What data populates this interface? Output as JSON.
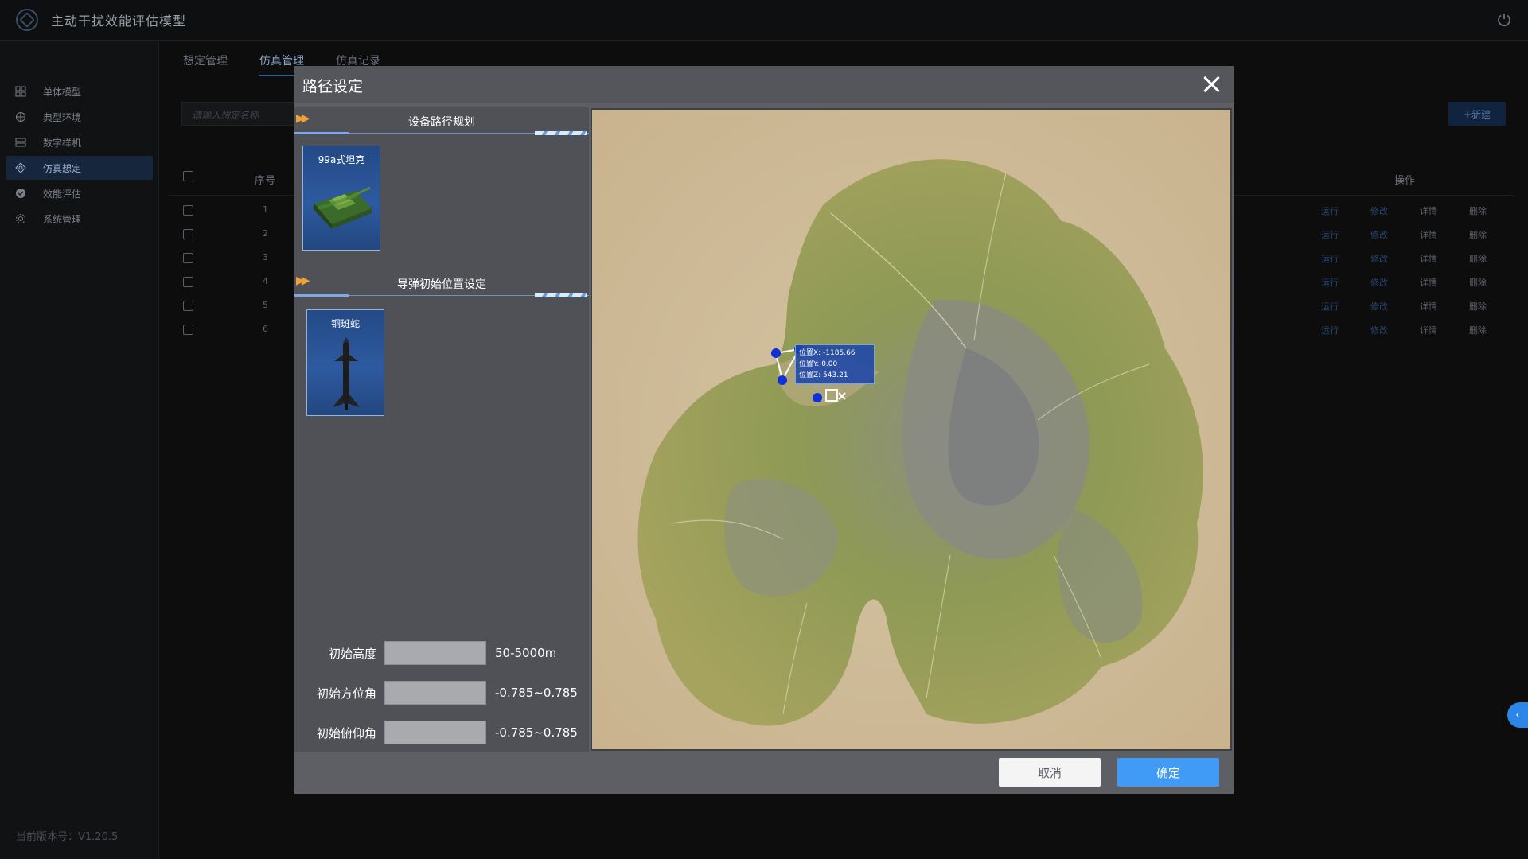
{
  "app": {
    "title": "主动干扰效能评估模型",
    "version_text": "当前版本号：V1.20.5"
  },
  "sidebar": {
    "items": [
      {
        "label": "单体模型",
        "icon": "model-icon"
      },
      {
        "label": "典型环境",
        "icon": "environment-icon"
      },
      {
        "label": "数字样机",
        "icon": "prototype-icon"
      },
      {
        "label": "仿真想定",
        "icon": "scenario-icon",
        "active": true
      },
      {
        "label": "效能评估",
        "icon": "evaluation-icon"
      },
      {
        "label": "系统管理",
        "icon": "settings-icon"
      }
    ]
  },
  "main": {
    "tabs": [
      "想定管理",
      "仿真管理",
      "仿真记录"
    ],
    "active_tab": 1,
    "search_placeholder": "请输入想定名称",
    "new_button": "+新建",
    "table": {
      "headers": {
        "index": "序号",
        "operations": "操作"
      },
      "rows": [
        {
          "index": "1"
        },
        {
          "index": "2"
        },
        {
          "index": "3"
        },
        {
          "index": "4"
        },
        {
          "index": "5"
        },
        {
          "index": "6"
        }
      ],
      "ops": {
        "run": "运行",
        "edit": "修改",
        "detail": "详情",
        "delete": "删除"
      }
    }
  },
  "dialog": {
    "title": "路径设定",
    "section1_title": "设备路径规划",
    "section2_title": "导弹初始位置设定",
    "tank_label": "99a式坦克",
    "missile_label": "铜斑蛇",
    "params": [
      {
        "label": "初始高度",
        "value": "",
        "range": "50-5000m"
      },
      {
        "label": "初始方位角",
        "value": "",
        "range": "-0.785~0.785"
      },
      {
        "label": "初始俯仰角",
        "value": "",
        "range": "-0.785~0.785"
      }
    ],
    "tooltip": {
      "x": "位置X: -1185.66",
      "y": "位置Y: 0.00",
      "z": "位置Z: 543.21"
    },
    "cancel_button": "取消",
    "ok_button": "确定"
  },
  "colors": {
    "accent": "#3f9bf6",
    "dialog_bg": "#5d5f64",
    "terrain_green": "#8f9a4a",
    "sand": "#cdb896"
  }
}
